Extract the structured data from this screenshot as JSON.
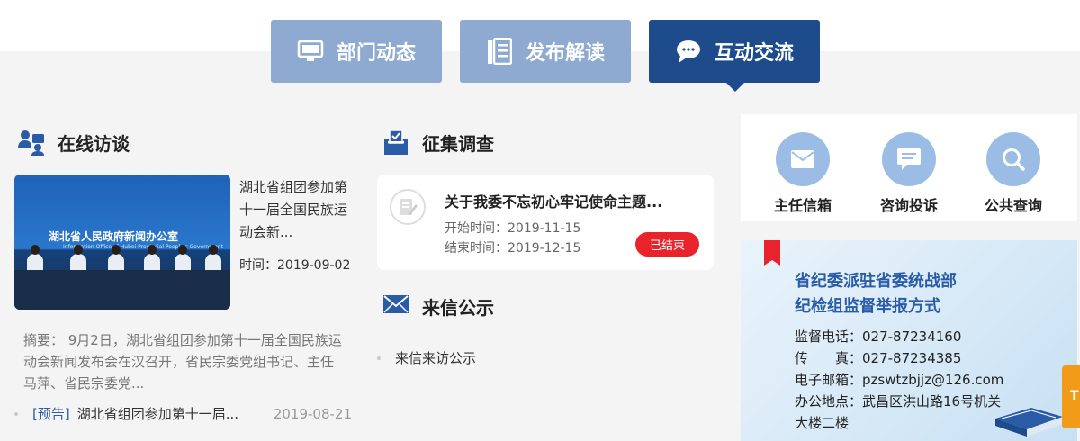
{
  "tabs": [
    {
      "label": "部门动态",
      "icon": "monitor-icon",
      "active": false
    },
    {
      "label": "发布解读",
      "icon": "document-icon",
      "active": false
    },
    {
      "label": "互动交流",
      "icon": "chat-icon",
      "active": true
    }
  ],
  "interview": {
    "heading": "在线访谈",
    "photo_banner": "湖北省人民政府新闻办公室",
    "photo_banner_en": "Information Office of Hubei Provincial People's Government",
    "title": "湖北省组团参加第十一届全国民族运动会新...",
    "time": "时间：2019-09-02",
    "abstract": "摘要： 9月2日，湖北省组团参加第十一届全国民族运动会新闻发布会在汉召开，省民宗委党组书记、主任马萍、省民宗委党...",
    "list": [
      {
        "tag": "[预告]",
        "title": "湖北省组团参加第十一届...",
        "date": "2019-08-21"
      }
    ]
  },
  "survey": {
    "heading": "征集调查",
    "card": {
      "title": "关于我委不忘初心牢记使命主题...",
      "start": "开始时间：2019-11-15",
      "end": "结束时间：2019-12-15",
      "status": "已结束"
    }
  },
  "letters": {
    "heading": "来信公示",
    "items": [
      "来信来访公示"
    ]
  },
  "services": [
    {
      "label": "主任信箱",
      "icon": "mail-icon"
    },
    {
      "label": "咨询投诉",
      "icon": "message-icon"
    },
    {
      "label": "公共查询",
      "icon": "search-icon"
    }
  ],
  "report": {
    "title1": "省纪委派驻省委统战部",
    "title2": "纪检组监督举报方式",
    "phone": "监督电话：027-87234160",
    "fax": "传　　真：027-87234385",
    "email": "电子邮箱：pzswtzbjjz@126.com",
    "address1": "办公地点：武昌区洪山路16号机关",
    "address2": "大楼二楼"
  },
  "side_tab": "T",
  "colors": {
    "tab_inactive": "#8eaad1",
    "tab_active": "#1d4b8c",
    "status_red": "#e8232b",
    "icon_blue": "#2a5ba6"
  }
}
